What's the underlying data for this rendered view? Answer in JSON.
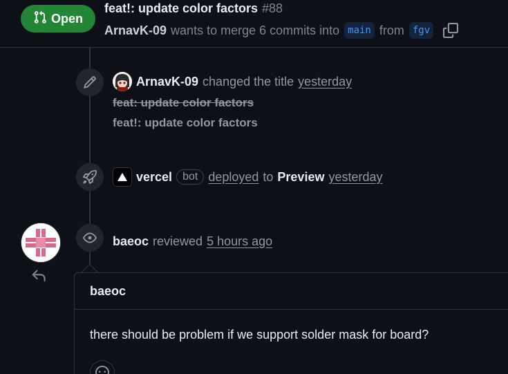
{
  "header": {
    "state": "Open",
    "title": "feat!: update color factors",
    "number": "#88",
    "author": "ArnavK-09",
    "merge_text": "wants to merge 6 commits into",
    "base_branch": "main",
    "from_text": "from",
    "head_branch": "fgv"
  },
  "timeline": {
    "title_change": {
      "actor": "ArnavK-09",
      "action": "changed the title",
      "time": "yesterday",
      "old_title": "feat: update color factors",
      "new_title": "feat!: update color factors"
    },
    "deployment": {
      "actor": "vercel",
      "bot_label": "bot",
      "action": "deployed",
      "to_text": "to",
      "environment": "Preview",
      "time": "yesterday"
    },
    "review": {
      "actor": "baeoc",
      "action": "reviewed",
      "time": "5 hours ago"
    }
  },
  "comment": {
    "author": "baeoc",
    "body": "there should be problem if we support solder mask for board?"
  },
  "colors": {
    "open_green": "#238636",
    "link_blue": "#4493f8",
    "background": "#0d1117",
    "border": "#30363d"
  },
  "icons": {
    "state": "git-pull-request-icon",
    "copy": "copy-icon",
    "rename": "pencil-icon",
    "deploy": "rocket-icon",
    "review": "eye-icon",
    "reply": "reply-arrow-icon",
    "reaction": "smiley-icon"
  }
}
